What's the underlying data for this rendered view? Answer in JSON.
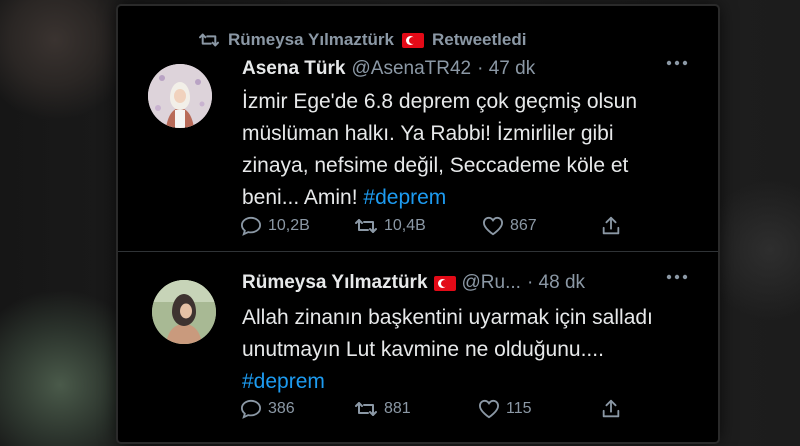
{
  "retweet_notice": "Rümeysa Yılmaztürk",
  "retweet_suffix": "Retweetledi",
  "tweets": [
    {
      "name": "Asena Türk",
      "handle": "@AsenaTR42",
      "time": "· 47 dk",
      "text_parts": [
        "İzmir Ege'de 6.8  deprem çok geçmiş olsun müslüman halkı. Ya Rabbi! İzmirliler gibi zinaya, nefsime değil, Seccademe köle et beni... Amin! "
      ],
      "hashtag": "#deprem",
      "replies": "10,2B",
      "retweets": "10,4B",
      "likes": "867"
    },
    {
      "name": "Rümeysa Yılmaztürk",
      "handle": "@Ru...",
      "time": "· 48 dk",
      "text_parts": [
        "Allah zinanın başkentini uyarmak için salladı unutmayın Lut kavmine ne olduğunu.... "
      ],
      "hashtag": "#deprem",
      "replies": "386",
      "retweets": "881",
      "likes": "115"
    }
  ],
  "icons": {
    "retweet": "retweet-icon",
    "reply": "reply-icon",
    "like": "heart-icon",
    "share": "share-icon",
    "more": "more-icon",
    "flag": "turkey-flag-icon"
  },
  "colors": {
    "background": "#000000",
    "text": "#e7e9ea",
    "muted": "#8b98a5",
    "link": "#1d9bf0"
  }
}
